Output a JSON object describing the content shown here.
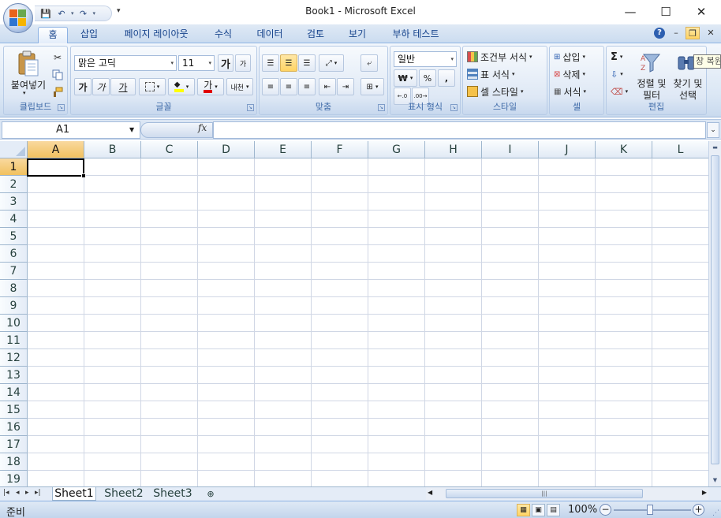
{
  "window": {
    "title": "Book1 - Microsoft Excel",
    "minimize": "—",
    "maximize": "☐",
    "close": "✕"
  },
  "qat": {
    "save_icon": "floppy-save-icon",
    "undo_icon": "undo-arrow-icon",
    "redo_icon": "redo-arrow-icon",
    "customize": "▾"
  },
  "tabs": [
    {
      "label": "홈",
      "active": true
    },
    {
      "label": "삽입"
    },
    {
      "label": "페이지 레이아웃"
    },
    {
      "label": "수식"
    },
    {
      "label": "데이터"
    },
    {
      "label": "검토"
    },
    {
      "label": "보기"
    },
    {
      "label": "부하 테스트"
    }
  ],
  "ribbon": {
    "clipboard": {
      "label": "클립보드",
      "paste_label": "붙여넣기"
    },
    "font": {
      "label": "글꼴",
      "font_name": "맑은 고딕",
      "font_size": "11",
      "grow": "가",
      "shrink": "가",
      "bold": "가",
      "italic": "가",
      "underline": "가",
      "font_color": "가",
      "phonetic": "내천"
    },
    "alignment": {
      "label": "맞춤"
    },
    "number": {
      "label": "표시 형식",
      "format": "일반",
      "currency": "₩",
      "percent": "%",
      "comma": ","
    },
    "styles": {
      "label": "스타일",
      "conditional": "조건부 서식",
      "table": "표 서식",
      "cell_style": "셀 스타일"
    },
    "cells": {
      "label": "셀",
      "insert": "삽입",
      "delete": "삭제",
      "format": "서식"
    },
    "editing": {
      "label": "편집",
      "sum": "Σ",
      "sort_line1": "정렬 및",
      "sort_line2": "필터",
      "find_line1": "찾기 및",
      "find_line2": "선택",
      "tooltip": "창 복원"
    }
  },
  "formula_bar": {
    "name_box": "A1",
    "fx": "fx",
    "value": ""
  },
  "grid": {
    "columns": [
      "A",
      "B",
      "C",
      "D",
      "E",
      "F",
      "G",
      "H",
      "I",
      "J",
      "K",
      "L"
    ],
    "rows": [
      "1",
      "2",
      "3",
      "4",
      "5",
      "6",
      "7",
      "8",
      "9",
      "10",
      "11",
      "12",
      "13",
      "14",
      "15",
      "16",
      "17",
      "18",
      "19"
    ],
    "active_cell": "A1"
  },
  "sheet_tabs": [
    {
      "label": "Sheet1",
      "active": true
    },
    {
      "label": "Sheet2"
    },
    {
      "label": "Sheet3"
    }
  ],
  "status": {
    "text": "준비",
    "zoom": "100%",
    "zoom_minus": "−",
    "zoom_plus": "+"
  },
  "colors": {
    "accent": "#15428b",
    "selection": "#f1c15f",
    "grid_line": "#d0d7e5"
  }
}
